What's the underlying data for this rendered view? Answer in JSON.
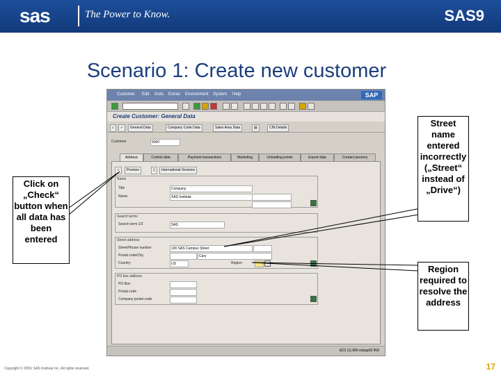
{
  "banner": {
    "logo": "sas",
    "tagline": "The Power to Know.",
    "product": "SAS9"
  },
  "slide": {
    "title": "Scenario 1: Create new customer",
    "copyright": "Copyright © 2009, SAS Institute Inc. All rights reserved.",
    "page": "17"
  },
  "sap": {
    "menu": [
      "Customer",
      "Edit",
      "Goto",
      "Extras",
      "Environment",
      "System",
      "Help"
    ],
    "logo": "SAP",
    "title": "Create Customer: General Data",
    "appbar": [
      "General Data",
      "Company Code Data",
      "Sales Area Data",
      "CIN Details"
    ],
    "customer_label": "Customer",
    "customer_value": "5000",
    "tabs": [
      "Address",
      "Control data",
      "Payment transactions",
      "Marketing",
      "Unloading points",
      "Export data",
      "Contact persons"
    ],
    "address_buttons": [
      "Preview",
      "International Versions"
    ],
    "name_group": {
      "title": "Name",
      "title_label": "Title",
      "title_value": "Company",
      "name_label": "Name",
      "name_value": "SAS Institute"
    },
    "search_group": {
      "title": "Search terms",
      "term_label": "Search term 1/2",
      "term_value": "SAS"
    },
    "street_group": {
      "title": "Street address",
      "street_label": "Street/House number",
      "street_value": "100 SAS Campus Street",
      "postal_label": "Postal code/City",
      "city_value": "Cary",
      "country_label": "Country",
      "country_value": "US",
      "region_label": "Region"
    },
    "pobox_group": {
      "title": "PO box address",
      "pobox_label": "PO Box",
      "postal_label": "Postal code",
      "company_label": "Company postal code"
    },
    "status": "ED1 (1) 800  edsap03  INS"
  },
  "callouts": {
    "check": "Click on „Check“ button when all data has been entered",
    "street": "Street name entered incorrectly („Street“ instead of „Drive“)",
    "region": "Region required to resolve the address"
  }
}
